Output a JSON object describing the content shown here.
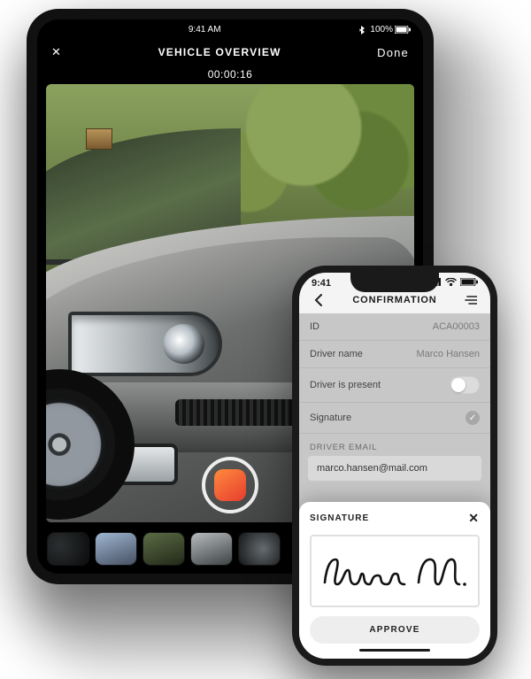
{
  "tablet": {
    "status": {
      "time": "9:41 AM",
      "battery": "100%",
      "bluetooth_icon": "bluetooth-icon",
      "battery_icon": "battery-icon"
    },
    "nav": {
      "close_label": "✕",
      "title": "VEHICLE OVERVIEW",
      "done_label": "Done"
    },
    "recording": {
      "timer": "00:00:16"
    },
    "photo_subject": "silver-sedan-front-left",
    "record_button": "record",
    "thumbnails": [
      "tyre-close",
      "front-3q-blue-sky",
      "front",
      "headlight",
      "wheel-alloy"
    ]
  },
  "phone": {
    "status": {
      "time": "9:41",
      "signal_icon": "signal-icon",
      "wifi_icon": "wifi-icon",
      "battery_icon": "battery-icon"
    },
    "nav": {
      "back_icon": "chevron-left",
      "title": "CONFIRMATION",
      "menu_icon": "menu-lines"
    },
    "form": {
      "id_label": "ID",
      "id_value": "ACA00003",
      "driver_name_label": "Driver name",
      "driver_name_value": "Marco Hansen",
      "driver_present_label": "Driver is present",
      "driver_present_value": false,
      "signature_label": "Signature",
      "signature_done": true,
      "driver_email_section": "DRIVER EMAIL",
      "driver_email_value": "marco.hansen@mail.com"
    },
    "sheet": {
      "title": "SIGNATURE",
      "close_label": "✕",
      "signature_text": "Hansen M.",
      "approve_label": "APPROVE"
    }
  }
}
